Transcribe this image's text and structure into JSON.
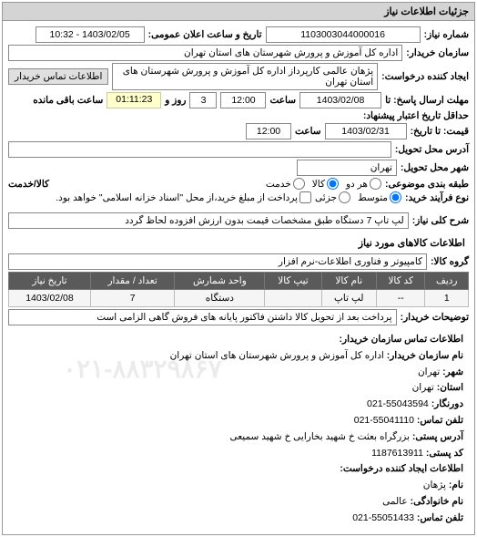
{
  "panel": {
    "title": "جزئیات اطلاعات نیاز"
  },
  "fields": {
    "need_number_label": "شماره نیاز:",
    "need_number": "1103003044000016",
    "announce_datetime_label": "تاریخ و ساعت اعلان عمومی:",
    "announce_datetime": "1403/02/05 - 10:32",
    "buyer_org_label": "سازمان خریدار:",
    "buyer_org": "اداره کل آموزش و پرورش شهرستان های استان تهران",
    "requester_label": "ایجاد کننده درخواست:",
    "requester": "پژهان عالمی کارپرداز اداره کل آموزش و پرورش شهرستان های استان تهران",
    "contact_btn": "اطلاعات تماس خریدار",
    "reply_deadline_label": "مهلت ارسال پاسخ: تا",
    "reply_date": "1403/02/08",
    "reply_time_label": "ساعت",
    "reply_time": "12:00",
    "days_label": "روز و",
    "days_value": "3",
    "time_remaining": "01:11:23",
    "remaining_label": "ساعت باقی مانده",
    "validity_label": "حداقل تاریخ اعتبار پیشنهاد:",
    "price_until_label": "قیمت: تا تاریخ:",
    "price_until_date": "1403/02/31",
    "price_until_time_label": "ساعت",
    "price_until_time": "12:00",
    "delivery_addr_label": "آدرس محل تحویل:",
    "delivery_city_label": "شهر محل تحویل:",
    "delivery_city": "تهران",
    "class_label": "طبقه بندی موضوعی:",
    "radio_all": "هر دو",
    "radio_goods": "کالا",
    "radio_service": "خدمت",
    "goods_service_label": "کالا/خدمت",
    "price_type_label": "نوع فرآیند خرید:",
    "radio_mid": "متوسط",
    "radio_small": "جزئی",
    "payment_note": "پرداخت از مبلغ خرید،از محل \"اسناد خزانه اسلامی\" خواهد بود.",
    "desc_label": "شرح کلی نیاز:",
    "desc_value": "لپ تاپ 7 دستگاه طبق مشخصات قیمت بدون ارزش افزوده لحاظ گردد"
  },
  "goods": {
    "section_title": "اطلاعات کالاهای مورد نیاز",
    "group_label": "گروه کالا:",
    "group_value": "کامپیوتر و فناوری اطلاعات-نرم افزار",
    "headers": [
      "ردیف",
      "کد کالا",
      "نام کالا",
      "تیپ کالا",
      "واحد شمارش",
      "تعداد / مقدار",
      "تاریخ نیاز"
    ],
    "rows": [
      [
        "1",
        "--",
        "لپ تاپ",
        "",
        "دستگاه",
        "7",
        "1403/02/08"
      ]
    ],
    "notes_label": "توضیحات خریدار:",
    "notes_value": "پرداخت بعد از تحویل کالا داشتن فاکتور پایانه های فروش گاهی الزامی است"
  },
  "contact": {
    "section_title": "اطلاعات تماس سازمان خریدار:",
    "org_label": "نام سازمان خریدار:",
    "org_value": "اداره کل آموزش و پرورش شهرستان های استان تهران",
    "city_label": "شهر:",
    "city_value": "تهران",
    "province_label": "استان:",
    "province_value": "تهران",
    "fax_label": "دورنگار:",
    "fax_value": "55043594-021",
    "phone_label": "تلفن تماس:",
    "phone_value": "55041110-021",
    "postal_label": "آدرس پستی:",
    "postal_value": "بزرگراه بعثت خ شهید بخارایی خ شهید سمیعی",
    "postcode_label": "کد پستی:",
    "postcode_value": "1187613911",
    "creator_section": "اطلاعات ایجاد کننده درخواست:",
    "name_label": "نام:",
    "name_value": "پژهان",
    "family_label": "نام خانوادگی:",
    "family_value": "عالمی",
    "cphone_label": "تلفن تماس:",
    "cphone_value": "55051433-021",
    "watermark": "۰۲۱-۸۸۳۲۹۸۶۷"
  }
}
